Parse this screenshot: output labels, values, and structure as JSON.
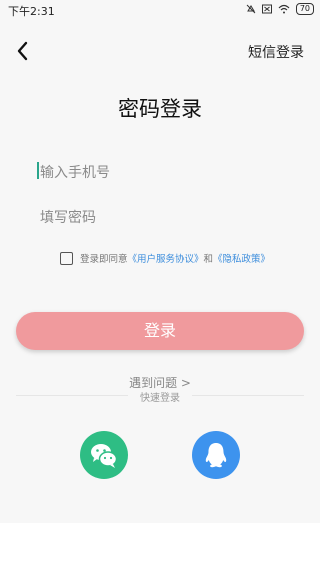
{
  "status_bar": {
    "time": "下午2:31",
    "battery": "70",
    "icons": [
      "do-not-disturb-icon",
      "box-icon",
      "wifi-icon",
      "battery-icon"
    ]
  },
  "header": {
    "back_icon": "chevron-left-icon",
    "sms_login_label": "短信登录"
  },
  "page": {
    "title": "密码登录"
  },
  "form": {
    "phone_placeholder": "输入手机号",
    "password_placeholder": "填写密码"
  },
  "agreement": {
    "prefix": "登录即同意",
    "user_agreement": "《用户服务协议》",
    "and": "和",
    "privacy_policy": "《隐私政策》"
  },
  "login_button": "登录",
  "help": {
    "problem_label": "遇到问题 >",
    "quick_login_label": "快速登录"
  },
  "social": {
    "wechat_icon": "wechat-icon",
    "qq_icon": "qq-icon"
  },
  "colors": {
    "login_button": "#f09a9d",
    "link": "#3c8ddc",
    "wechat": "#2ebd84",
    "qq": "#3d93ee",
    "cursor": "#2aa58b"
  }
}
